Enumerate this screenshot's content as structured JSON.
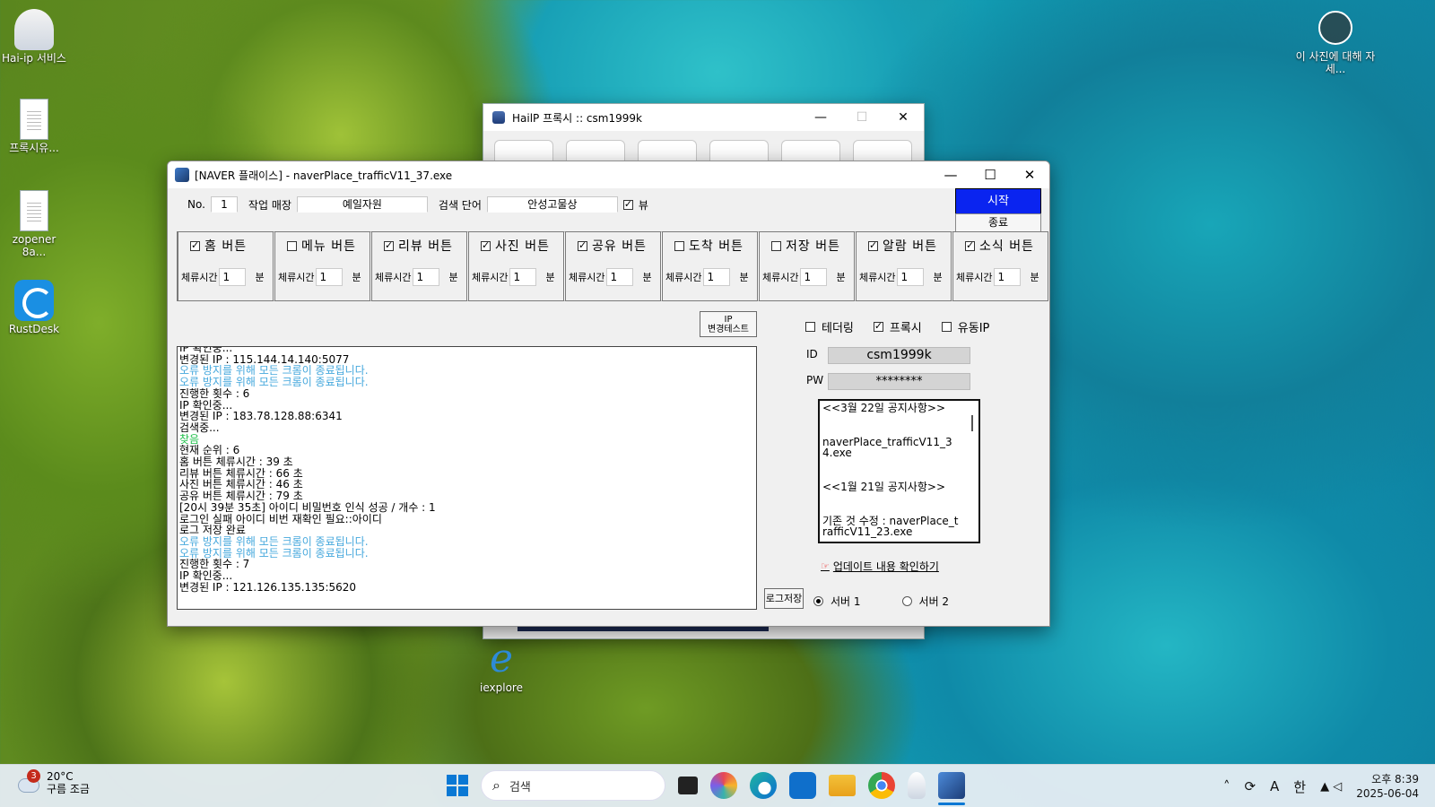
{
  "desktop": {
    "icons_left": [
      {
        "label": "Hai-ip 서비스",
        "icon": "rocket-icon"
      },
      {
        "label": "프록시유...",
        "icon": "document-icon"
      },
      {
        "label": "zopener 8a...",
        "icon": "document-icon"
      },
      {
        "label": "RustDesk",
        "icon": "rustdesk-icon"
      }
    ],
    "photo_info_label": "이 사진에 대해 자세...",
    "iexplore_label": "iexplore"
  },
  "bg_window": {
    "title": "HailP 프록시 :: csm1999k",
    "minimize": "—",
    "maximize": "☐",
    "close": "✕"
  },
  "main_window": {
    "title": "[NAVER 플래이스] - naverPlace_trafficV11_37.exe",
    "minimize": "—",
    "maximize": "☐",
    "close": "✕",
    "no_label": "No.",
    "no_value": "1",
    "store_label": "작업 매장",
    "store_value": "예일자원",
    "keyword_label": "검색 단어",
    "keyword_value": "안성고물상",
    "view_label": "뷰",
    "view_checked": true,
    "start_button": "시작",
    "stop_button": "종료",
    "groups": [
      {
        "label": "홈 버튼",
        "checked": true,
        "stay_label": "체류시간",
        "stay_value": "1",
        "unit": "분"
      },
      {
        "label": "메뉴 버튼",
        "checked": false,
        "stay_label": "체류시간",
        "stay_value": "1",
        "unit": "분"
      },
      {
        "label": "리뷰 버튼",
        "checked": true,
        "stay_label": "체류시간",
        "stay_value": "1",
        "unit": "분"
      },
      {
        "label": "사진 버튼",
        "checked": true,
        "stay_label": "체류시간",
        "stay_value": "1",
        "unit": "분"
      },
      {
        "label": "공유 버튼",
        "checked": true,
        "stay_label": "체류시간",
        "stay_value": "1",
        "unit": "분"
      },
      {
        "label": "도착 버튼",
        "checked": false,
        "stay_label": "체류시간",
        "stay_value": "1",
        "unit": "분"
      },
      {
        "label": "저장 버튼",
        "checked": false,
        "stay_label": "체류시간",
        "stay_value": "1",
        "unit": "분"
      },
      {
        "label": "알람 버튼",
        "checked": true,
        "stay_label": "체류시간",
        "stay_value": "1",
        "unit": "분"
      },
      {
        "label": "소식 버튼",
        "checked": true,
        "stay_label": "체류시간",
        "stay_value": "1",
        "unit": "분"
      }
    ],
    "ip_test_button_line1": "IP",
    "ip_test_button_line2": "변경테스트",
    "log_lines": [
      {
        "text": "IP 확인중...",
        "color": "black"
      },
      {
        "text": "변경된 IP : 115.144.14.140:5077",
        "color": "black"
      },
      {
        "text": "오류 방지를 위해 모든 크롬이 종료됩니다.",
        "color": "blue"
      },
      {
        "text": "오류 방지를 위해 모든 크롬이 종료됩니다.",
        "color": "blue"
      },
      {
        "text": "진행한 횟수 : 6",
        "color": "black"
      },
      {
        "text": "IP 확인중...",
        "color": "black"
      },
      {
        "text": "변경된 IP : 183.78.128.88:6341",
        "color": "black"
      },
      {
        "text": "검색중...",
        "color": "black"
      },
      {
        "text": "찾음",
        "color": "green"
      },
      {
        "text": "현재 순위 : 6",
        "color": "black"
      },
      {
        "text": "홈 버튼 체류시간 : 39 초",
        "color": "black"
      },
      {
        "text": "리뷰 버튼 체류시간 : 66 초",
        "color": "black"
      },
      {
        "text": "사진 버튼 체류시간 : 46 초",
        "color": "black"
      },
      {
        "text": "공유 버튼 체류시간 : 79 초",
        "color": "black"
      },
      {
        "text": "[20시 39분 35초] 아이디 비밀번호 인식 성공 / 개수 : 1",
        "color": "black"
      },
      {
        "text": "로그인 실패 아이디 비번 재확인 필요::아이디",
        "color": "black"
      },
      {
        "text": "로그 저장 완료",
        "color": "black"
      },
      {
        "text": "오류 방지를 위해 모든 크롬이 종료됩니다.",
        "color": "blue"
      },
      {
        "text": "오류 방지를 위해 모든 크롬이 종료됩니다.",
        "color": "blue"
      },
      {
        "text": "진행한 횟수 : 7",
        "color": "black"
      },
      {
        "text": "IP 확인중...",
        "color": "black"
      },
      {
        "text": "변경된 IP : 121.126.135.135:5620",
        "color": "black"
      }
    ],
    "options": [
      {
        "label": "테더링",
        "checked": false
      },
      {
        "label": "프록시",
        "checked": true
      },
      {
        "label": "유동IP",
        "checked": false
      }
    ],
    "id_label": "ID",
    "id_value": "csm1999k",
    "pw_label": "PW",
    "pw_value": "********",
    "notice_lines": [
      "<<3월 22일 공지사항>>",
      "naverPlace_trafficV11_34.exe",
      "<<1월 21일 공지사항>>",
      "기존 것 수정 : naverPlace_trafficV11_23.exe"
    ],
    "update_link": "업데이트 내용 확인하기",
    "log_save_button": "로그저장",
    "servers": [
      {
        "label": "서버 1",
        "selected": true
      },
      {
        "label": "서버 2",
        "selected": false
      }
    ]
  },
  "taskbar": {
    "weather_badge": "3",
    "temperature": "20°C",
    "weather_text": "구름 조금",
    "search_placeholder": "검색",
    "tray_lang": "A",
    "tray_ime": "한",
    "time": "오후 8:39",
    "date": "2025-06-04"
  }
}
